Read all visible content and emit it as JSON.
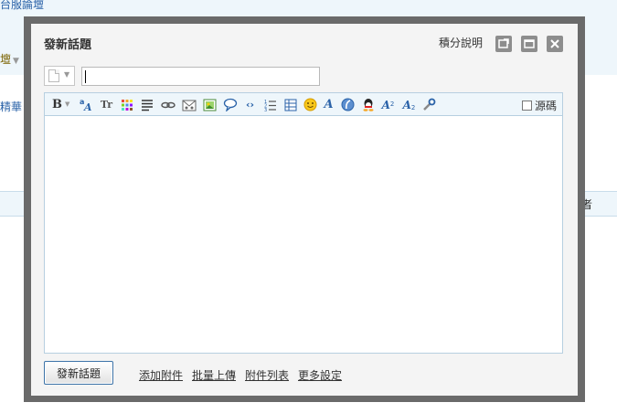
{
  "background": {
    "top_link": "台服論壇",
    "forum_select": "壇",
    "digest_link": "精華",
    "author_header": "作者"
  },
  "dialog": {
    "title": "發新話題",
    "score_help": "積分說明",
    "subject_value": "",
    "source_label": "源碼",
    "submit_label": "發新話題",
    "footer_links": [
      "添加附件",
      "批量上傳",
      "附件列表",
      "更多設定"
    ]
  },
  "toolbar_icons": [
    "bold-icon",
    "font-color-icon",
    "font-size-icon",
    "background-color-icon",
    "align-icon",
    "link-icon",
    "email-icon",
    "image-icon",
    "quote-icon",
    "code-icon",
    "list-icon",
    "table-icon",
    "emoticon-icon",
    "italic-font-icon",
    "flash-icon",
    "qq-icon",
    "superscript-icon",
    "subscript-icon",
    "tools-icon"
  ],
  "colors": {
    "frame": "#6a6a6a",
    "dialog_bg": "#f4f4f4",
    "toolbar_bg": "#eef6fb",
    "link_blue": "#2a62a8",
    "button_border": "#3c73a8"
  }
}
